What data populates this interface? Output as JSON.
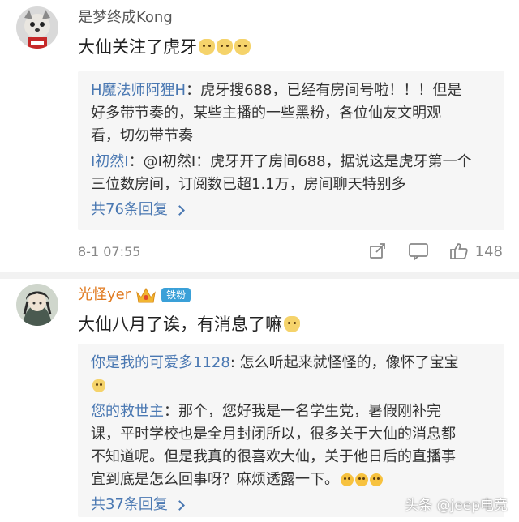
{
  "comments": [
    {
      "username": "是梦终成Kong",
      "text": "大仙关注了虎牙",
      "replies": [
        {
          "author": "H魔法师阿狸H",
          "lines": [
            "：虎牙搜688，已经有房间号啦！！！但是",
            "好多带节奏的，某些主播的一些黑粉，各位仙友文明观",
            "看，切勿带节奏"
          ]
        },
        {
          "author": "I初然I",
          "lines": [
            "：@I初然I：虎牙开了房间688，据说这是虎牙第一个",
            "三位数房间，订阅数已超1.1万，房间聊天特别多"
          ]
        }
      ],
      "more_replies": "共76条回复",
      "time": "8-1 07:55",
      "likes": "148"
    },
    {
      "username": "光怪yer",
      "badge": "铁粉",
      "text": "大仙八月了诶，有消息了嘛",
      "replies": [
        {
          "author": "你是我的可爱多1128",
          "lines": [
            ": 怎么听起来就怪怪的，像怀了宝宝",
            ""
          ]
        },
        {
          "author": "您的救世主",
          "lines": [
            "：那个，您好我是一名学生党，暑假刚补完",
            "课，平时学校也是全月封闭所以，很多关于大仙的消息都",
            "不知道呢。但是我真的很喜欢大仙，关于他日后的直播事",
            "宜到底是怎么回事呀？麻烦透露一下。"
          ]
        }
      ],
      "more_replies": "共37条回复"
    }
  ],
  "watermark": "头条 @jeep电竞",
  "icons": {
    "share": "share-icon",
    "comment": "comment-icon",
    "like": "thumbs-up-icon"
  },
  "colors": {
    "link": "#4a78b2",
    "username_vip": "#e07a1f",
    "badge": "#3aa0d8"
  }
}
